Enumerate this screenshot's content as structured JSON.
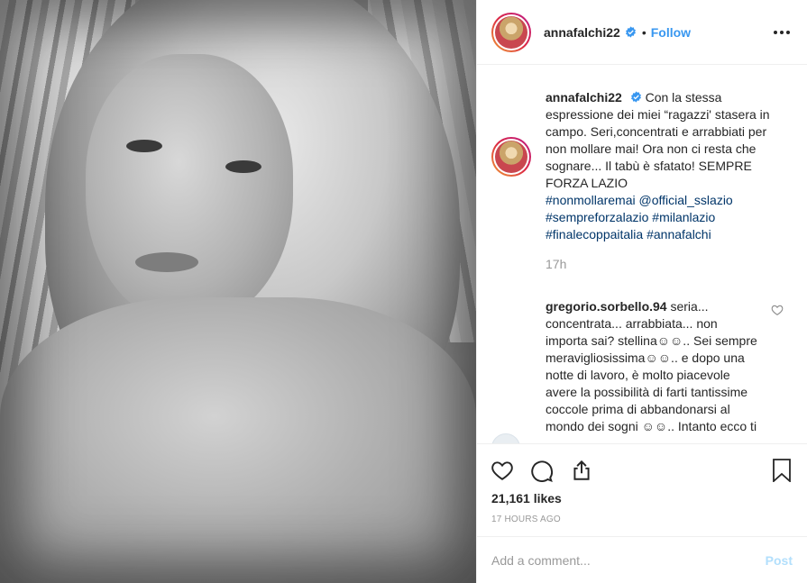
{
  "header": {
    "username": "annafalchi22",
    "separator": "•",
    "follow_label": "Follow"
  },
  "caption": {
    "username": "annafalchi22",
    "text": "Con la stessa espressione dei miei “ragazzi' stasera in campo. Seri,concentrati e arrabbiati per non mollare mai! Ora non ci resta che sognare... Il tabù è sfatato! SEMPRE FORZA LAZIO",
    "tags": [
      "#nonmollaremai",
      "@official_sslazio",
      "#sempreforzalazio",
      "#milanlazio",
      "#finalecoppaitalia",
      "#annafalchi"
    ],
    "time": "17h"
  },
  "comment": {
    "username": "gregorio.sorbello.94",
    "text": "seria... concentrata... arrabbiata... non importa sai? stellina☺☺.. Sei sempre meravigliosissima☺☺.. e dopo una notte di lavoro, è molto piacevole avere la possibilità di farti tantissime coccole prima di abbandonarsi al mondo dei sogni ☺☺.. Intanto ecco ti"
  },
  "actions": {
    "likes": "21,161 likes",
    "time": "17 HOURS AGO"
  },
  "add_comment": {
    "placeholder": "Add a comment...",
    "post_label": "Post"
  },
  "colors": {
    "link": "#3897f0",
    "tag": "#003569",
    "muted": "#999999",
    "post_disabled": "#b2dffc"
  }
}
